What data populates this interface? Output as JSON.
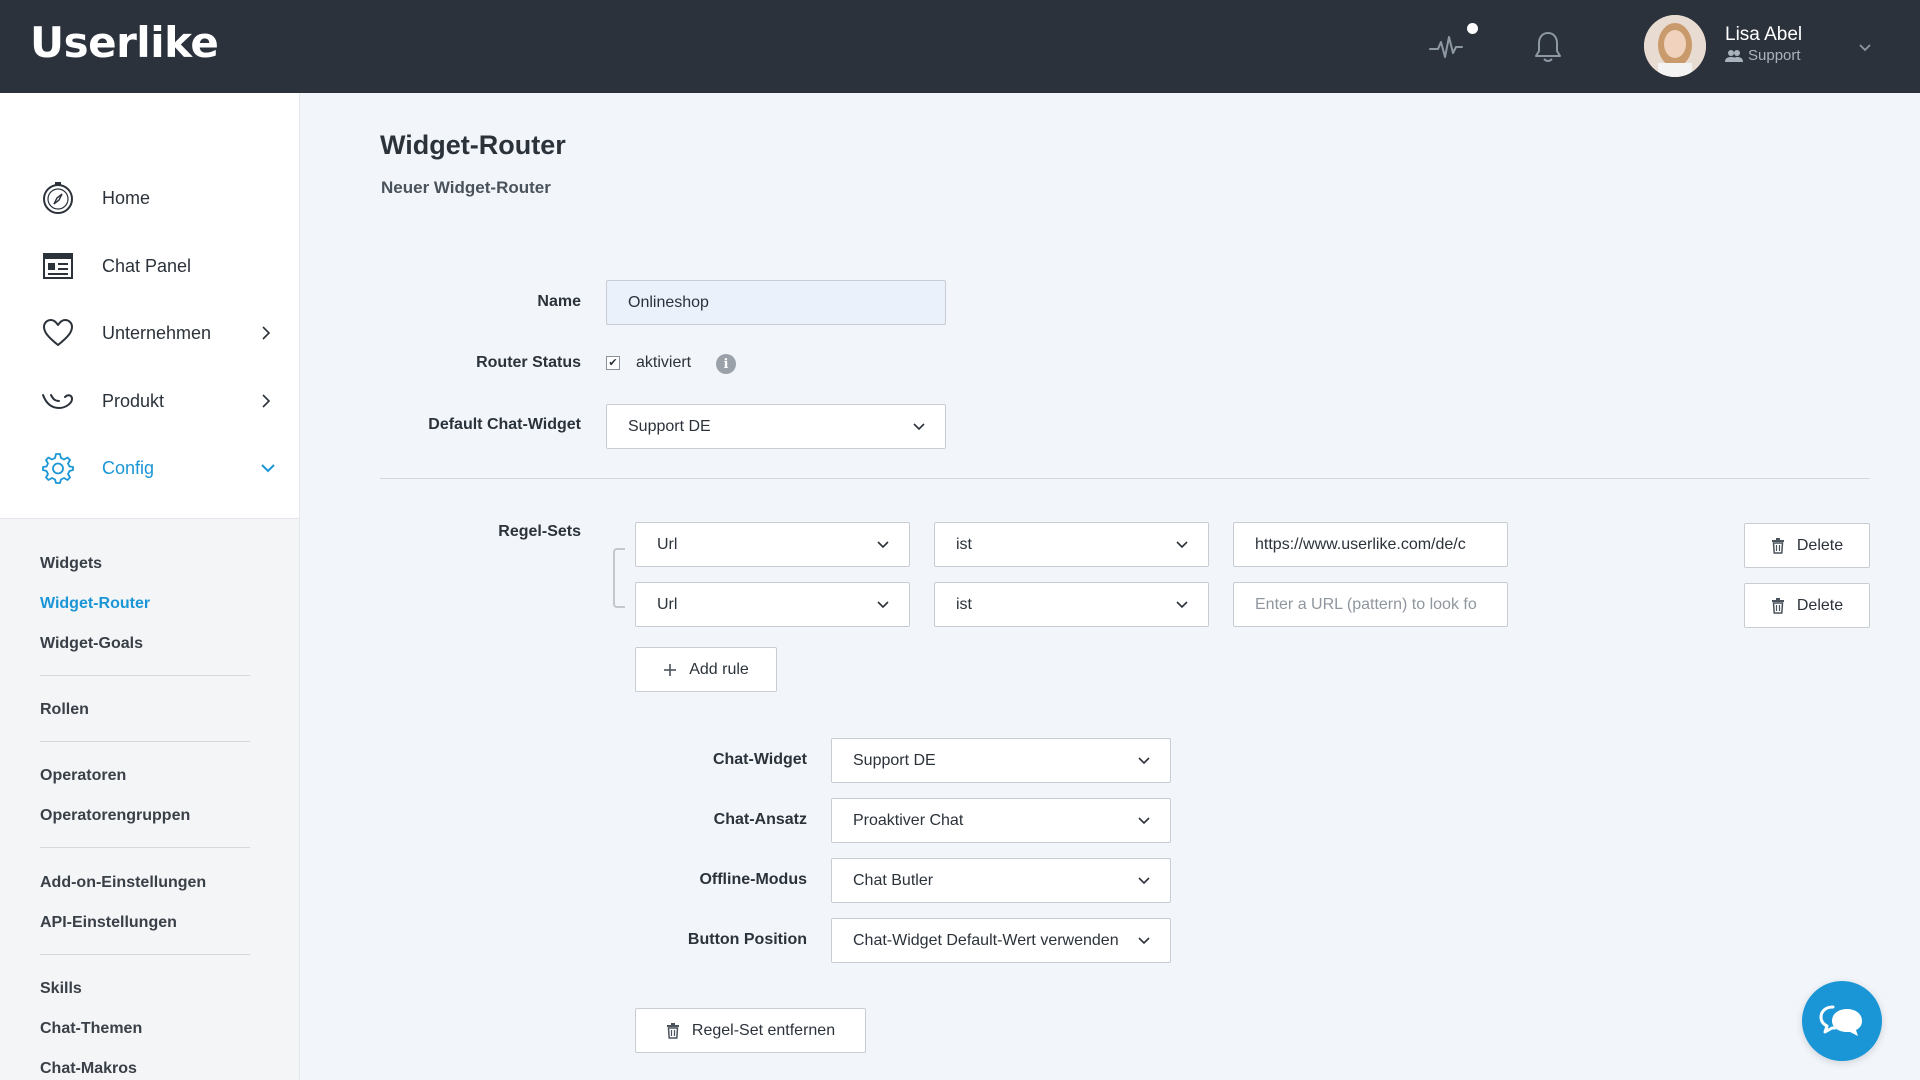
{
  "app": {
    "logo_text": "Userlike"
  },
  "header": {
    "user": {
      "name": "Lisa Abel",
      "role": "Support"
    }
  },
  "sidebar": {
    "main_items": [
      {
        "label": "Home",
        "icon": "compass-icon"
      },
      {
        "label": "Chat Panel",
        "icon": "chat-panel-icon"
      },
      {
        "label": "Unternehmen",
        "icon": "heart-icon"
      },
      {
        "label": "Produkt",
        "icon": "product-icon"
      },
      {
        "label": "Config",
        "icon": "gear-icon"
      }
    ],
    "sub_items": {
      "widgets": "Widgets",
      "widget_router": "Widget-Router",
      "widget_goals": "Widget-Goals",
      "rollen": "Rollen",
      "operatoren": "Operatoren",
      "operatorengruppen": "Operatorengruppen",
      "addon": "Add-on-Einstellungen",
      "api": "API-Einstellungen",
      "skills": "Skills",
      "chat_themen": "Chat-Themen",
      "chat_makros": "Chat-Makros"
    }
  },
  "page": {
    "title": "Widget-Router",
    "subtitle": "Neuer Widget-Router"
  },
  "form": {
    "name_label": "Name",
    "name_value": "Onlineshop",
    "router_status_label": "Router Status",
    "router_status_checked": true,
    "router_status_text": "aktiviert",
    "default_widget_label": "Default Chat-Widget",
    "default_widget_value": "Support DE",
    "rule_sets_label": "Regel-Sets",
    "rules": [
      {
        "field": "Url",
        "operator": "ist",
        "value": "https://www.userlike.com/de/c",
        "placeholder": ""
      },
      {
        "field": "Url",
        "operator": "ist",
        "value": "",
        "placeholder": "Enter a URL (pattern) to look fo"
      }
    ],
    "delete_label": "Delete",
    "add_rule_label": "Add rule",
    "chat_widget_label": "Chat-Widget",
    "chat_widget_value": "Support DE",
    "chat_ansatz_label": "Chat-Ansatz",
    "chat_ansatz_value": "Proaktiver Chat",
    "offline_modus_label": "Offline-Modus",
    "offline_modus_value": "Chat Butler",
    "button_position_label": "Button Position",
    "button_position_value": "Chat-Widget Default-Wert verwenden",
    "remove_rule_set_label": "Regel-Set entfernen"
  },
  "colors": {
    "topbar": "#2b323c",
    "accent": "#1a96d6",
    "page_bg": "#f2f6fb"
  }
}
